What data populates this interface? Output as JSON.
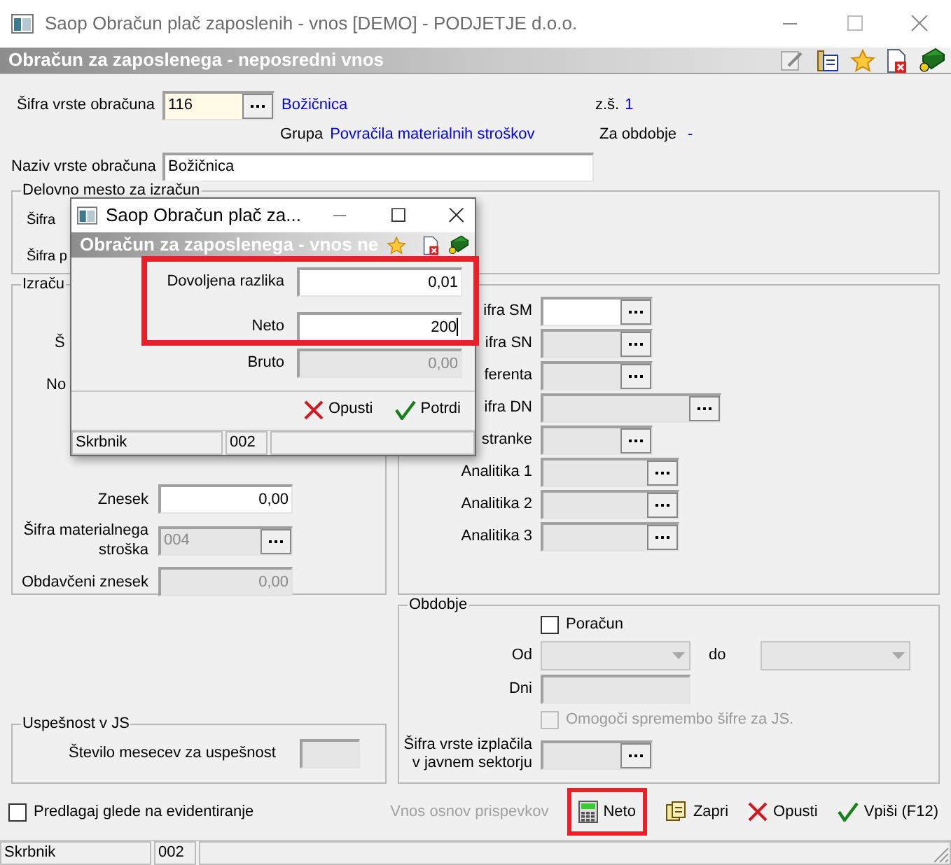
{
  "window": {
    "title": "Saop Obračun plač zaposlenih - vnos [DEMO] - PODJETJE d.o.o."
  },
  "header": {
    "title": "Obračun za zaposlenega - neposredni vnos"
  },
  "form": {
    "sifra": {
      "label": "Šifra vrste obračuna",
      "value": "116",
      "name": "Božičnica"
    },
    "zs": {
      "label": "z.š.",
      "value": "1"
    },
    "grupa": {
      "label": "Grupa",
      "value": "Povračila materialnih stroškov"
    },
    "za_obdobje": {
      "label": "Za obdobje",
      "value": "-"
    },
    "naziv": {
      "label": "Naziv vrste obračuna",
      "value": "Božičnica"
    }
  },
  "delovno_mesto": {
    "legend": "Delovno mesto za izračun",
    "labels": [
      "Šifra",
      "Šifra p"
    ]
  },
  "izracun": {
    "legend": "Izraču",
    "partial_labels": [
      "Š",
      "No"
    ],
    "fields": [
      {
        "label": "Znesek",
        "value": "0,00",
        "disabled": false,
        "button": false
      },
      {
        "label": "Šifra materialnega stroška",
        "value": "004",
        "disabled": true,
        "button": true
      },
      {
        "label": "Obdavčeni znesek",
        "value": "0,00",
        "disabled": true,
        "button": false
      }
    ]
  },
  "right_fields": [
    {
      "label": "ifra SM",
      "kind": "short",
      "disabled": false
    },
    {
      "label": "ifra SN",
      "kind": "short",
      "disabled": true
    },
    {
      "label": "ferenta",
      "kind": "short",
      "disabled": true
    },
    {
      "label": "ifra DN",
      "kind": "long",
      "disabled": true
    },
    {
      "label": "stranke",
      "kind": "short",
      "disabled": true
    },
    {
      "label": "Analitika 1",
      "kind": "medium",
      "disabled": true
    },
    {
      "label": "Analitika 2",
      "kind": "medium",
      "disabled": true
    },
    {
      "label": "Analitika 3",
      "kind": "medium",
      "disabled": true
    }
  ],
  "obdobje": {
    "legend": "Obdobje",
    "poracun": {
      "label": "Poračun",
      "checked": false,
      "disabled": false
    },
    "od": {
      "label": "Od"
    },
    "do": {
      "label": "do"
    },
    "dni": {
      "label": "Dni"
    },
    "omogoci": {
      "label": "Omogoči spremembo šifre za JS.",
      "checked": false,
      "disabled": true
    },
    "izplacilo": {
      "label": "Šifra vrste izplačila v javnem sektorju"
    }
  },
  "uspesnost": {
    "legend": "Uspešnost v JS",
    "label": "Število mesecev za uspešnost"
  },
  "footer": {
    "checkbox": {
      "label": "Predlagaj glede na evidentiranje",
      "checked": false,
      "disabled": false
    },
    "buttons": [
      {
        "label": "Vnos osnov prispevkov",
        "disabled": true
      },
      {
        "label": "Neto",
        "disabled": false
      },
      {
        "label": "Zapri",
        "disabled": false
      },
      {
        "label": "Opusti",
        "disabled": false
      },
      {
        "label": "Vpiši (F12)",
        "disabled": false
      }
    ]
  },
  "status_bar": [
    "Skrbnik",
    "002"
  ],
  "dialog": {
    "title": "Saop Obračun plač za...",
    "header": "Obračun za zaposlenega - vnos ne",
    "fields": [
      {
        "label": "Dovoljena razlika",
        "value": "0,01",
        "disabled": false
      },
      {
        "label": "Neto",
        "value": "200",
        "disabled": false
      },
      {
        "label": "Bruto",
        "value": "0,00",
        "disabled": true
      }
    ],
    "buttons": [
      {
        "label": "Opusti"
      },
      {
        "label": "Potrdi"
      }
    ],
    "status_bar": [
      "Skrbnik",
      "002"
    ]
  }
}
